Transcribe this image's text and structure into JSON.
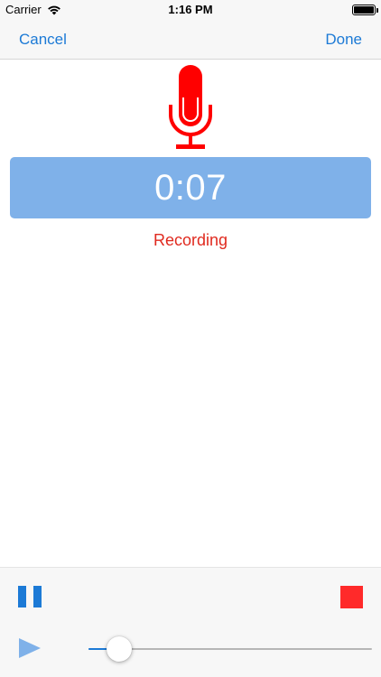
{
  "status_bar": {
    "carrier": "Carrier",
    "time": "1:16 PM",
    "wifi_icon": "wifi-icon",
    "battery_icon": "battery-icon"
  },
  "nav": {
    "cancel_label": "Cancel",
    "done_label": "Done"
  },
  "recorder": {
    "mic_icon": "microphone-icon",
    "elapsed": "0:07",
    "state": "Recording"
  },
  "toolbar": {
    "pause_icon": "pause-icon",
    "stop_icon": "stop-icon",
    "play_icon": "play-icon",
    "playback_progress": 0.07
  },
  "colors": {
    "accent": "#1c7ad6",
    "timer_background": "#7fb1e9",
    "recording_text": "#e02a1f",
    "mic": "#ff0000",
    "stop": "#ff2a2a",
    "play": "#7fb1e9"
  }
}
